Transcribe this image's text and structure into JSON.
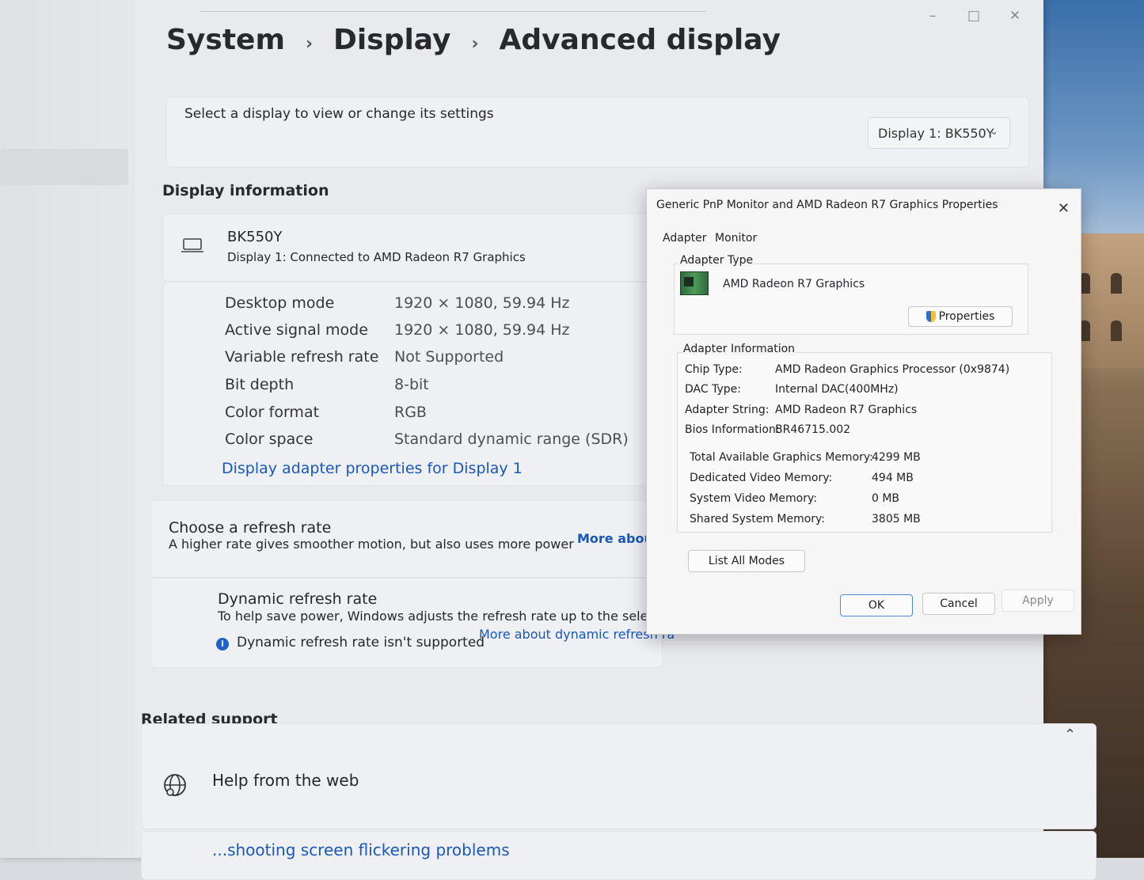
{
  "breadcrumb": {
    "items": [
      "System",
      "Display",
      "Advanced display"
    ],
    "separator": "›"
  },
  "window_controls": {
    "minimize": "–",
    "maximize": "□",
    "close": "✕"
  },
  "display_select": {
    "label": "Select a display to view or change its settings",
    "selected": "Display 1: BK550Y"
  },
  "display_information": {
    "heading": "Display information",
    "monitor_name": "BK550Y",
    "monitor_status": "Display 1: Connected to AMD Radeon R7 Graphics",
    "rows": [
      {
        "key": "Desktop mode",
        "value": "1920 × 1080, 59.94 Hz"
      },
      {
        "key": "Active signal mode",
        "value": "1920 × 1080, 59.94 Hz"
      },
      {
        "key": "Variable refresh rate",
        "value": "Not Supported"
      },
      {
        "key": "Bit depth",
        "value": "8-bit"
      },
      {
        "key": "Color format",
        "value": "RGB"
      },
      {
        "key": "Color space",
        "value": "Standard dynamic range (SDR)"
      }
    ],
    "adapter_link": "Display adapter properties for Display 1"
  },
  "refresh_rate": {
    "title": "Choose a refresh rate",
    "description": "A higher rate gives smoother motion, but also uses more power",
    "more_link": "More about re"
  },
  "dynamic_refresh": {
    "title": "Dynamic refresh rate",
    "description": "To help save power, Windows adjusts the refresh rate up to the selected",
    "info_icon": "i",
    "notice": "Dynamic refresh rate isn't supported",
    "more_link": "More about dynamic refresh ra"
  },
  "related_support": {
    "heading": "Related support",
    "collapse_icon": "⌃",
    "help_web": "Help from the web",
    "flicker": "...shooting screen flickering problems"
  },
  "dialog": {
    "title": "Generic PnP Monitor and AMD Radeon R7 Graphics Properties",
    "close": "✕",
    "tabs": [
      "Adapter",
      "Monitor"
    ],
    "adapter_type_label": "Adapter Type",
    "adapter_name": "AMD Radeon R7 Graphics",
    "properties_button": "Properties",
    "adapter_info_label": "Adapter Information",
    "info_rows": [
      {
        "key": "Chip Type:",
        "value": "AMD Radeon Graphics Processor (0x9874)"
      },
      {
        "key": "DAC Type:",
        "value": "Internal DAC(400MHz)"
      },
      {
        "key": "Adapter String:",
        "value": "AMD Radeon R7 Graphics"
      },
      {
        "key": "Bios Information:",
        "value": "BR46715.002"
      }
    ],
    "memory_rows": [
      {
        "key": "Total Available Graphics Memory:",
        "value": "4299 MB"
      },
      {
        "key": "Dedicated Video Memory:",
        "value": "494 MB"
      },
      {
        "key": "System Video Memory:",
        "value": "0 MB"
      },
      {
        "key": "Shared System Memory:",
        "value": "3805 MB"
      }
    ],
    "list_modes_button": "List All Modes",
    "ok": "OK",
    "cancel": "Cancel",
    "apply": "Apply"
  }
}
